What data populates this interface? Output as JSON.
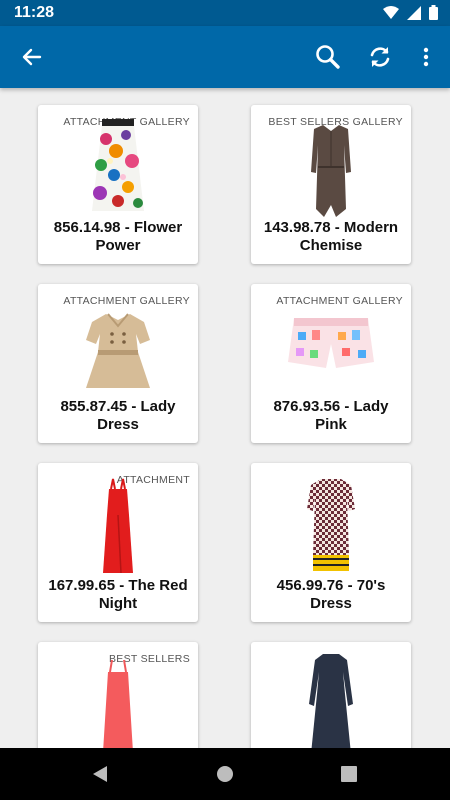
{
  "status_bar": {
    "time": "11:28"
  },
  "app_bar": {
    "back_icon": "arrow-back-icon",
    "search_icon": "search-icon",
    "refresh_icon": "refresh-icon",
    "more_icon": "more-vert-icon",
    "color": "#0068a8"
  },
  "products": [
    {
      "badge": "ATTACHMENT GALLERY",
      "title": "856.14.98 - Flower Power",
      "image": "floral-skirt"
    },
    {
      "badge": "BEST SELLERS GALLERY",
      "title": "143.98.78 - Modern Chemise",
      "image": "brown-shirt-dress"
    },
    {
      "badge": "ATTACHMENT GALLERY",
      "title": "855.87.45 - Lady Dress",
      "image": "beige-trench-dress"
    },
    {
      "badge": "ATTACHMENT GALLERY",
      "title": "876.93.56 - Lady Pink",
      "image": "pink-print-shorts"
    },
    {
      "badge": "ATTACHMENT",
      "title": "167.99.65 - The Red Night",
      "image": "red-gown"
    },
    {
      "badge": "",
      "title": "456.99.76 - 70's Dress",
      "image": "checkered-dress"
    },
    {
      "badge": "BEST SELLERS",
      "title": "",
      "image": "coral-slip-dress"
    },
    {
      "badge": "",
      "title": "",
      "image": "navy-long-dress"
    }
  ],
  "nav_bar": {
    "back": "nav-back-icon",
    "home": "nav-home-icon",
    "recents": "nav-recents-icon"
  }
}
